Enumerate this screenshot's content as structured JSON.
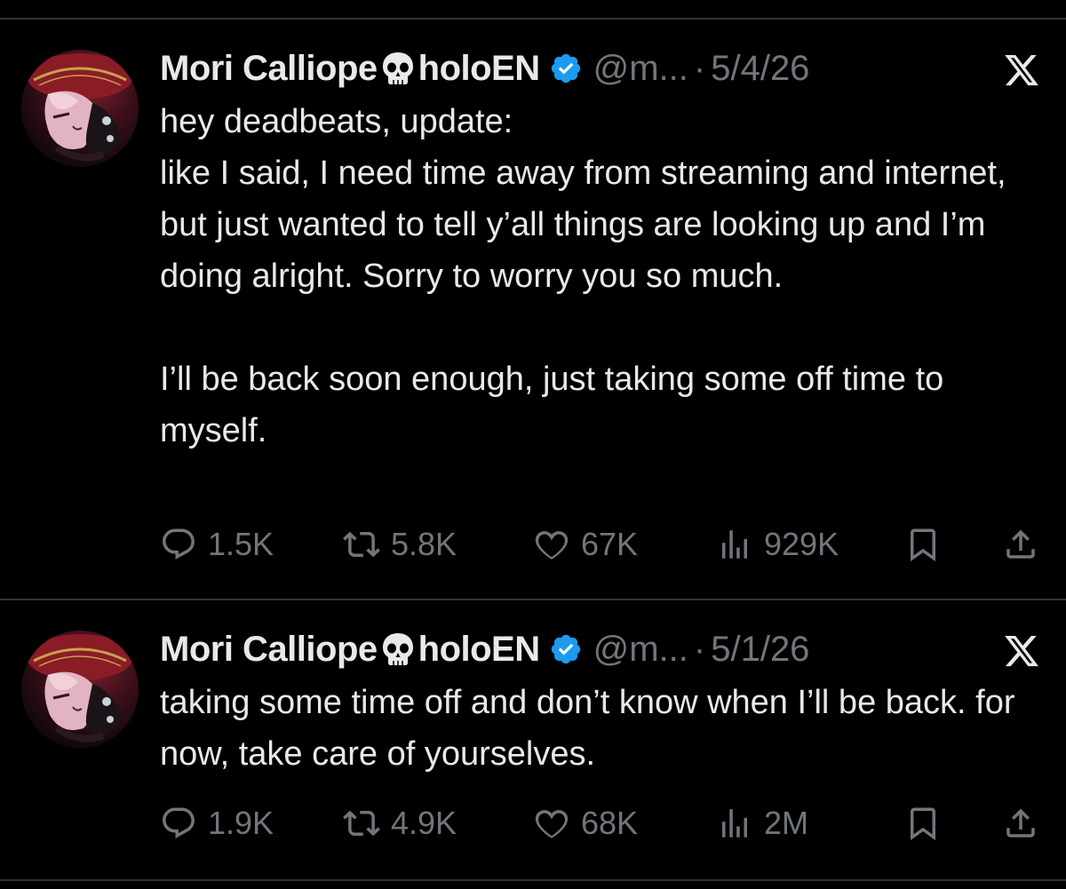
{
  "tweets": [
    {
      "author_name": "Mori Calliope",
      "author_suffix": "holoEN",
      "handle": "@m...",
      "separator": "·",
      "date": "5/4/26",
      "text": "hey deadbeats, update:\nlike I said, I need time away from streaming and internet, but just wanted to tell y’all things are looking up and I’m doing alright. Sorry to worry you so much.\n\nI’ll be back soon enough, just taking some off time to myself.",
      "replies": "1.5K",
      "reposts": "5.8K",
      "likes": "67K",
      "views": "929K"
    },
    {
      "author_name": "Mori Calliope",
      "author_suffix": "holoEN",
      "handle": "@m...",
      "separator": "·",
      "date": "5/1/26",
      "text": "taking some time off and don’t know when I’ll be back. for now, take care of yourselves.",
      "replies": "1.9K",
      "reposts": "4.9K",
      "likes": "68K",
      "views": "2M"
    }
  ],
  "icons": {
    "name_emoji": "skull-icon",
    "verified": "verified-badge-icon",
    "platform": "x-logo-icon",
    "reply": "reply-icon",
    "repost": "repost-icon",
    "like": "heart-icon",
    "views": "views-icon",
    "bookmark": "bookmark-icon",
    "share": "share-icon"
  },
  "colors": {
    "background": "#000000",
    "text": "#e7e9ea",
    "muted": "#71767b",
    "verified": "#1d9bf0",
    "divider": "#2f3336"
  }
}
